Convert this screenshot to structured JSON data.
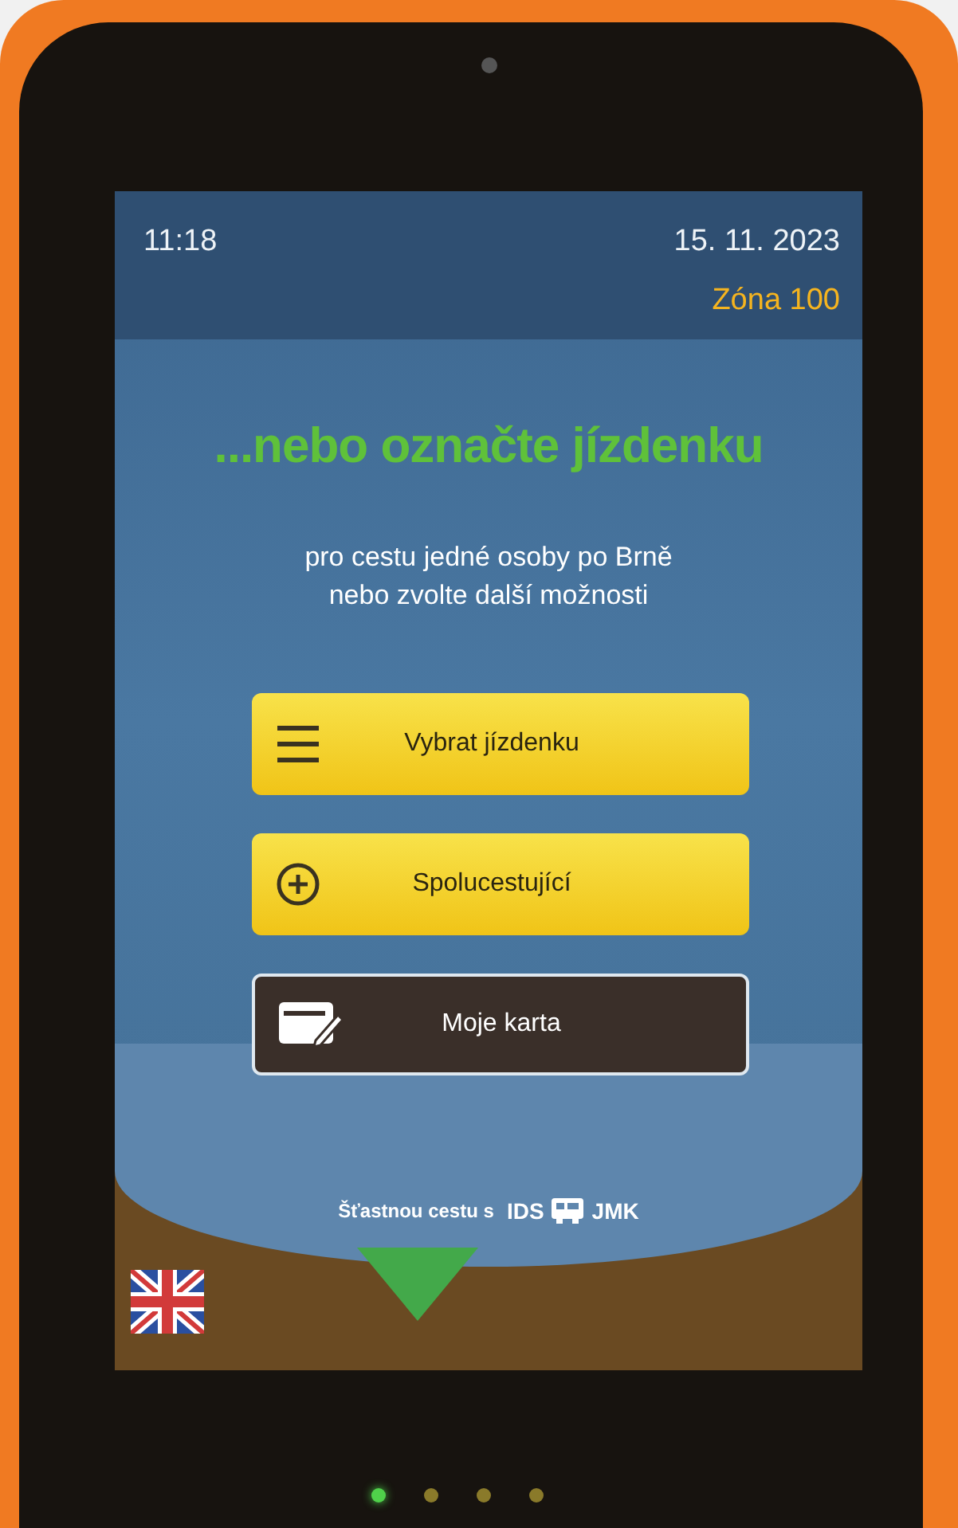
{
  "status_bar": {
    "time": "11:18",
    "date": "15. 11. 2023",
    "zone": "Zóna 100"
  },
  "heading": "...nebo označte jízdenku",
  "subtitle_lines": [
    "pro cestu jedné osoby po Brně",
    "nebo zvolte další možnosti"
  ],
  "buttons": [
    {
      "label": "Vybrat jízdenku",
      "kind": "menu"
    },
    {
      "label": "Spolucestující",
      "kind": "plus"
    },
    {
      "label": "Moje karta",
      "kind": "card"
    }
  ],
  "footer": {
    "text": "Šťastnou cestu s",
    "logo_left": "IDS",
    "logo_right": "JMK"
  },
  "indicators": [
    {
      "on": true
    },
    {
      "on": false
    },
    {
      "on": false
    },
    {
      "on": false
    }
  ]
}
